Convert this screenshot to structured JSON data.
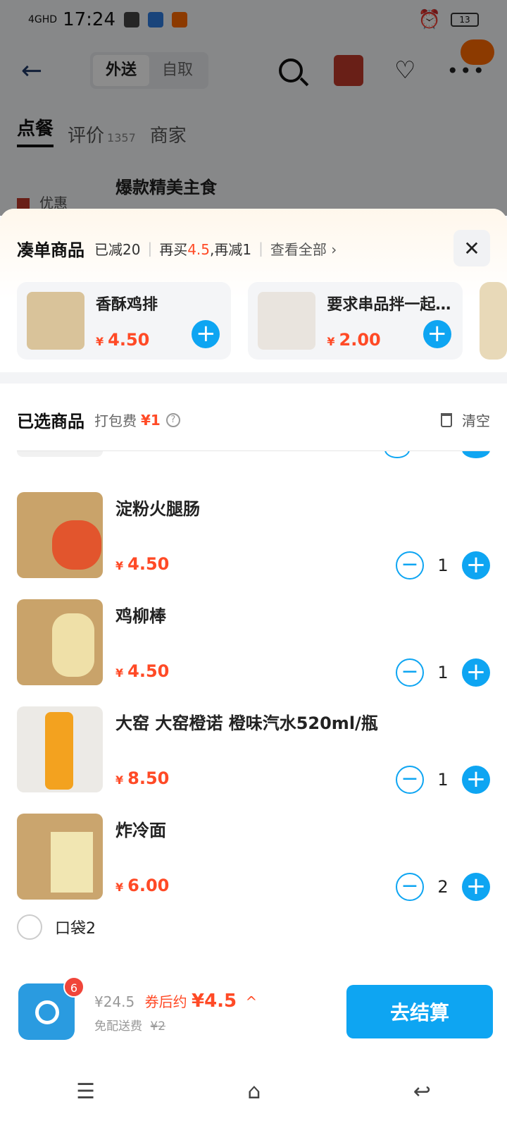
{
  "status_bar": {
    "network": "4GHD",
    "time": "17:24",
    "battery": "13"
  },
  "nav": {
    "tab_delivery": "外送",
    "tab_pickup": "自取"
  },
  "store_tabs": {
    "order": "点餐",
    "reviews": "评价",
    "reviews_count": "1357",
    "merchant": "商家"
  },
  "category_heading": "爆款精美主食",
  "side_category": "优惠",
  "addon": {
    "title": "凑单商品",
    "reduced": "已减20",
    "buy_more_prefix": "再买",
    "buy_more_amount": "4.5",
    "buy_more_suffix": ",再减1",
    "view_all": "查看全部 ›",
    "items": [
      {
        "name": "香酥鸡排",
        "price": "4.50"
      },
      {
        "name": "要求串品拌一起…",
        "price": "2.00"
      }
    ]
  },
  "selected": {
    "title": "已选商品",
    "packing_fee_label": "打包费",
    "packing_fee": "¥1",
    "clear": "清空",
    "items": [
      {
        "name": "淀粉火腿肠",
        "price": "4.50",
        "qty": "1"
      },
      {
        "name": "鸡柳棒",
        "price": "4.50",
        "qty": "1"
      },
      {
        "name": "大窑 大窑橙诺 橙味汽水520ml/瓶",
        "price": "8.50",
        "qty": "1"
      },
      {
        "name": "炸冷面",
        "price": "6.00",
        "qty": "2"
      }
    ]
  },
  "pocket_label": "口袋2",
  "footer": {
    "cart_badge": "6",
    "total": "¥24.5",
    "after_coupon_label": "券后约",
    "after_coupon_amount": "¥4.5",
    "free_delivery": "免配送费",
    "delivery_original": "¥2",
    "checkout": "去结算"
  },
  "currency_symbol": "¥"
}
